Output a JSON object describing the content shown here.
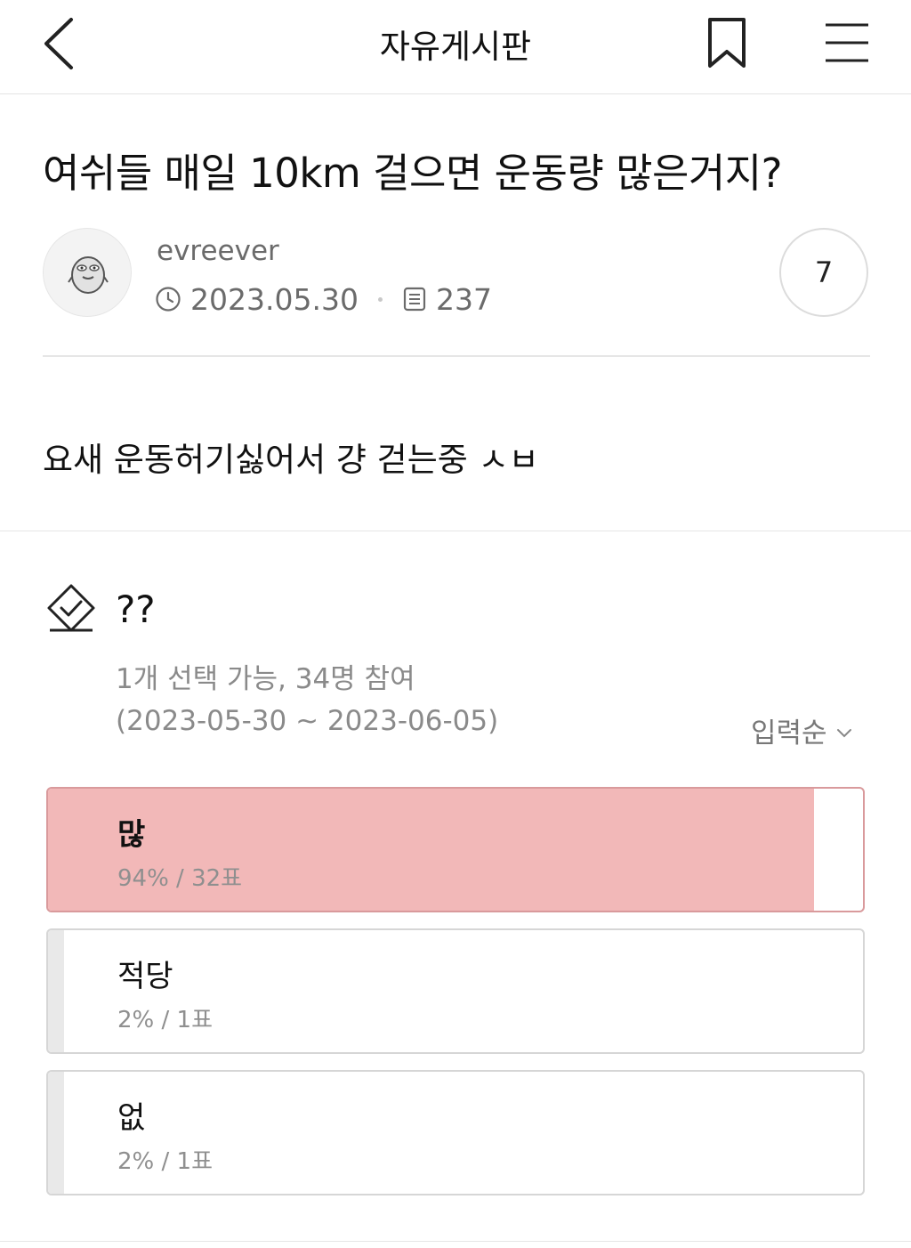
{
  "header": {
    "title": "자유게시판",
    "back_icon": "chevron-left-icon",
    "bookmark_icon": "bookmark-icon",
    "menu_icon": "hamburger-menu-icon"
  },
  "post": {
    "title": "여쉬들 매일 10km 걸으면 운동량 많은거지?",
    "author": "evreever",
    "date": "2023.05.30",
    "views": "237",
    "comment_count": "7",
    "body": "요새 운동허기싫어서 걍 걷는중 ㅅㅂ"
  },
  "poll": {
    "icon": "vote-check-icon",
    "title": "??",
    "info": "1개 선택 가능, 34명 참여",
    "period": "(2023-05-30 ~ 2023-06-05)",
    "sort_label": "입력순",
    "options": [
      {
        "label": "많",
        "result": "94% / 32표",
        "percent": 94,
        "color": "#f2b8b8"
      },
      {
        "label": "적당",
        "result": "2% / 1표",
        "percent": 2,
        "color": "#e9e9e9"
      },
      {
        "label": "없",
        "result": "2% / 1표",
        "percent": 2,
        "color": "#e9e9e9"
      }
    ]
  }
}
